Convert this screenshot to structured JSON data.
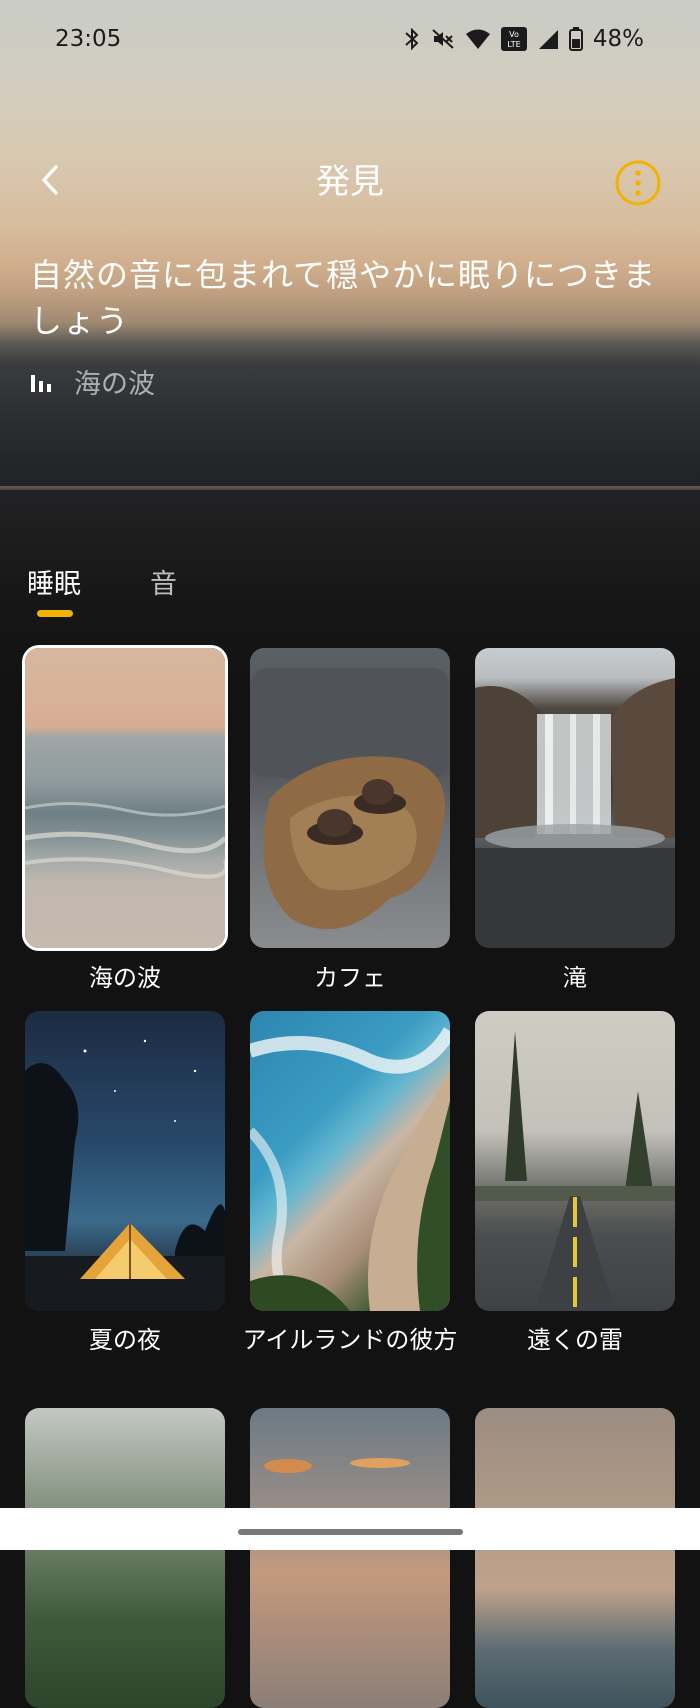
{
  "status": {
    "time": "23:05",
    "battery": "48%"
  },
  "header": {
    "title": "発見"
  },
  "hero": {
    "headline": "自然の音に包まれて穏やかに眠りにつきましょう",
    "now_playing": "海の波"
  },
  "tabs": [
    {
      "label": "睡眠",
      "active": true
    },
    {
      "label": "音",
      "active": false
    }
  ],
  "cards": [
    {
      "label": "海の波",
      "selected": true
    },
    {
      "label": "カフェ"
    },
    {
      "label": "滝"
    },
    {
      "label": "夏の夜"
    },
    {
      "label": "アイルランドの彼方"
    },
    {
      "label": "遠くの雷"
    },
    {
      "label": ""
    },
    {
      "label": ""
    },
    {
      "label": ""
    }
  ],
  "colors": {
    "accent": "#f0b400",
    "background": "#121212"
  }
}
